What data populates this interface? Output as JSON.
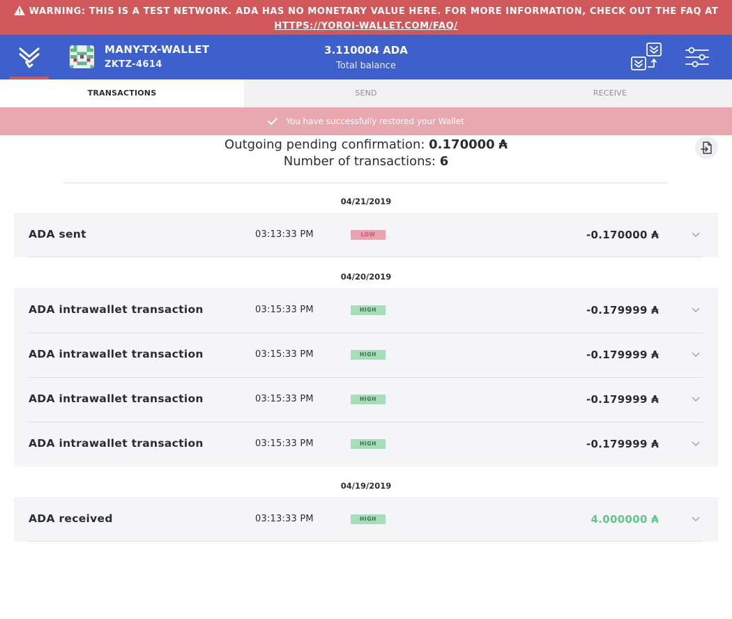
{
  "warning": {
    "text": "WARNING: THIS IS A TEST NETWORK. ADA HAS NO MONETARY VALUE HERE. FOR MORE INFORMATION, CHECK OUT THE FAQ AT",
    "link": "HTTPS://YOROI-WALLET.COM/FAQ/"
  },
  "wallet": {
    "name": "MANY-TX-WALLET",
    "plate": "ZKTZ-4614",
    "balance": "3.110004 ADA",
    "balance_label": "Total balance"
  },
  "tabs": [
    {
      "label": "TRANSACTIONS",
      "active": true
    },
    {
      "label": "SEND",
      "active": false
    },
    {
      "label": "RECEIVE",
      "active": false
    }
  ],
  "notice": {
    "text": "You have successfully restored your Wallet"
  },
  "summary": {
    "pending_label": "Outgoing pending confirmation:",
    "pending_value": "0.170000",
    "count_label": "Number of transactions:",
    "count_value": "6",
    "currency_symbol": "₳"
  },
  "groups": [
    {
      "date": "04/21/2019",
      "transactions": [
        {
          "type": "ADA sent",
          "time": "03:13:33 PM",
          "level": "LOW",
          "amount": "-0.170000",
          "positive": false
        }
      ]
    },
    {
      "date": "04/20/2019",
      "transactions": [
        {
          "type": "ADA intrawallet transaction",
          "time": "03:15:33 PM",
          "level": "HIGH",
          "amount": "-0.179999",
          "positive": false
        },
        {
          "type": "ADA intrawallet transaction",
          "time": "03:15:33 PM",
          "level": "HIGH",
          "amount": "-0.179999",
          "positive": false
        },
        {
          "type": "ADA intrawallet transaction",
          "time": "03:15:33 PM",
          "level": "HIGH",
          "amount": "-0.179999",
          "positive": false
        },
        {
          "type": "ADA intrawallet transaction",
          "time": "03:15:33 PM",
          "level": "HIGH",
          "amount": "-0.179999",
          "positive": false
        }
      ]
    },
    {
      "date": "04/19/2019",
      "transactions": [
        {
          "type": "ADA received",
          "time": "03:13:33 PM",
          "level": "HIGH",
          "amount": "4.000000",
          "positive": true
        }
      ]
    }
  ],
  "colors": {
    "topbar": "#3d60cd",
    "warning": "#d0585a",
    "notice": "#e8a8af",
    "badge_low": "#eaa2b2",
    "badge_high": "#a4dfb9",
    "received_amount": "#5ec78c"
  }
}
